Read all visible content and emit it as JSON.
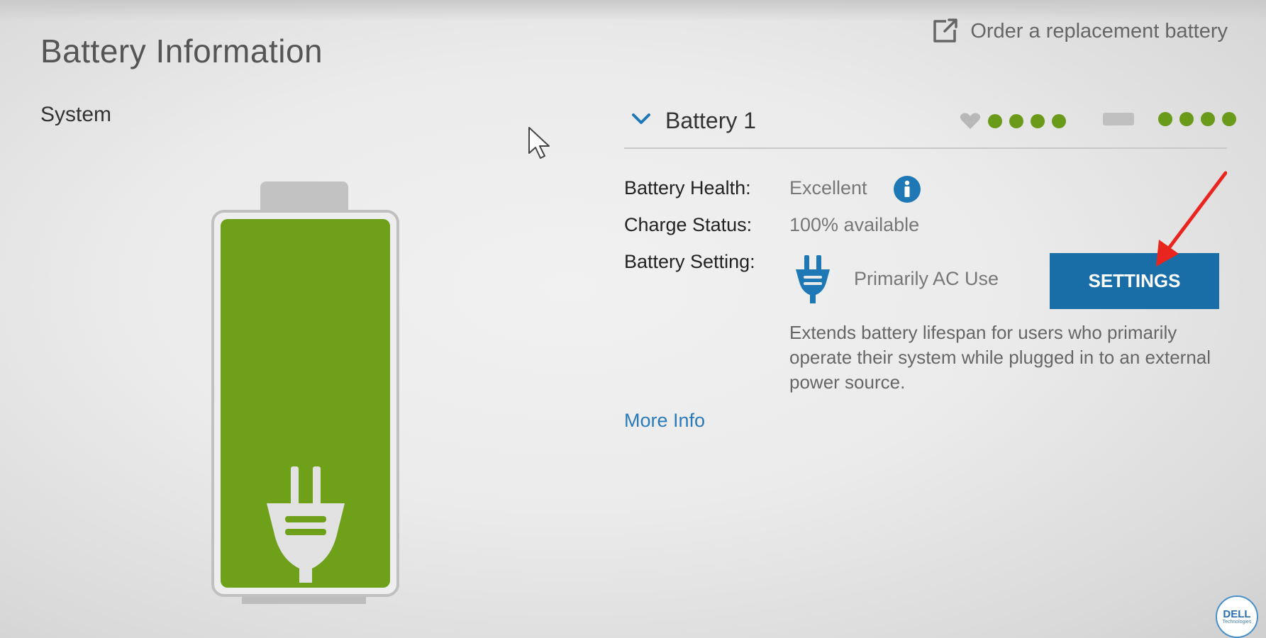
{
  "header": {
    "title": "Battery Information",
    "order_link": "Order a replacement battery"
  },
  "system": {
    "label": "System",
    "battery_level": 1.0,
    "color": "#6fa01a"
  },
  "battery": {
    "title": "Battery 1",
    "health_rating": 4,
    "charge_rating": 4,
    "indicator_color": "#6a9a1a",
    "health_label": "Battery Health:",
    "health_value": "Excellent",
    "charge_label": "Charge Status:",
    "charge_value": "100% available",
    "setting_label": "Battery Setting:",
    "setting_value": "Primarily AC Use",
    "settings_button": "SETTINGS",
    "description": "Extends battery lifespan for users who primarily operate their system while plugged in to an external power source.",
    "more_info": "More Info"
  },
  "brand": {
    "logo_word": "DELL",
    "logo_sub": "Technologies"
  },
  "colors": {
    "accent": "#1a6ea8",
    "link": "#2b7ab9",
    "annotation_arrow": "#e8261f"
  }
}
